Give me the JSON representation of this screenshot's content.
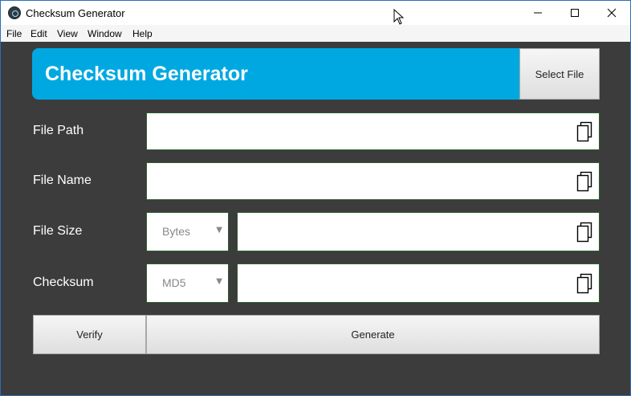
{
  "window": {
    "title": "Checksum Generator"
  },
  "menu": {
    "items": [
      "File",
      "Edit",
      "View",
      "Window",
      "Help"
    ]
  },
  "header": {
    "title": "Checksum Generator",
    "select_file_label": "Select File",
    "accent_color": "#00a8e2"
  },
  "fields": {
    "file_path": {
      "label": "File Path",
      "value": ""
    },
    "file_name": {
      "label": "File Name",
      "value": ""
    },
    "file_size": {
      "label": "File Size",
      "unit": "Bytes",
      "value": ""
    },
    "checksum": {
      "label": "Checksum",
      "algorithm": "MD5",
      "value": ""
    }
  },
  "actions": {
    "verify_label": "Verify",
    "generate_label": "Generate"
  },
  "icons": {
    "copy": "copy-icon",
    "app": "app-icon",
    "dropdown": "chevron-down-icon"
  }
}
